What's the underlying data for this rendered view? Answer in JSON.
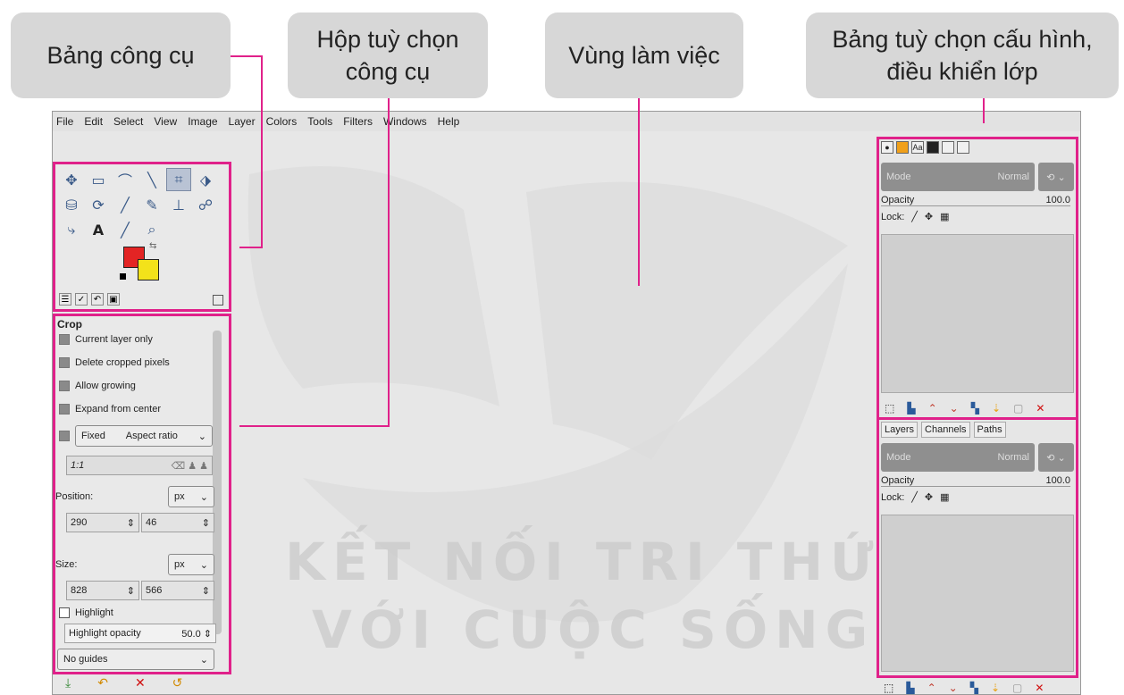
{
  "callouts": {
    "toolbox": "Bảng công cụ",
    "tool_options_line1": "Hộp tuỳ chọn",
    "tool_options_line2": "công cụ",
    "workspace": "Vùng làm việc",
    "dock_line1": "Bảng tuỳ chọn cấu hình,",
    "dock_line2": "điều khiển lớp"
  },
  "menubar": [
    "File",
    "Edit",
    "Select",
    "View",
    "Image",
    "Layer",
    "Colors",
    "Tools",
    "Filters",
    "Windows",
    "Help"
  ],
  "watermark": {
    "line1": "KẾT NỐI TRI THỨC",
    "line2": "VỚI CUỘC SỐNG"
  },
  "tool_options": {
    "title": "Crop",
    "checkboxes": [
      "Current layer only",
      "Delete cropped pixels",
      "Allow growing",
      "Expand from center"
    ],
    "fixed_label": "Fixed",
    "fixed_value": "Aspect ratio",
    "ratio_value": "1:1",
    "position_label": "Position:",
    "position_unit": "px",
    "position_x": "290",
    "position_y": "46",
    "size_label": "Size:",
    "size_unit": "px",
    "size_w": "828",
    "size_h": "566",
    "highlight_label": "Highlight",
    "highlight_opacity_label": "Highlight opacity",
    "highlight_opacity_value": "50.0",
    "guides_value": "No guides"
  },
  "dock": {
    "mode_label": "Mode",
    "mode_value": "Normal",
    "opacity_label": "Opacity",
    "opacity_value": "100.0",
    "lock_label": "Lock:",
    "tabs": [
      "Layers",
      "Channels",
      "Paths"
    ]
  },
  "colors": {
    "accent_pink": "#e0218a",
    "fg_color": "#e32424",
    "bg_color": "#f3e21a"
  }
}
